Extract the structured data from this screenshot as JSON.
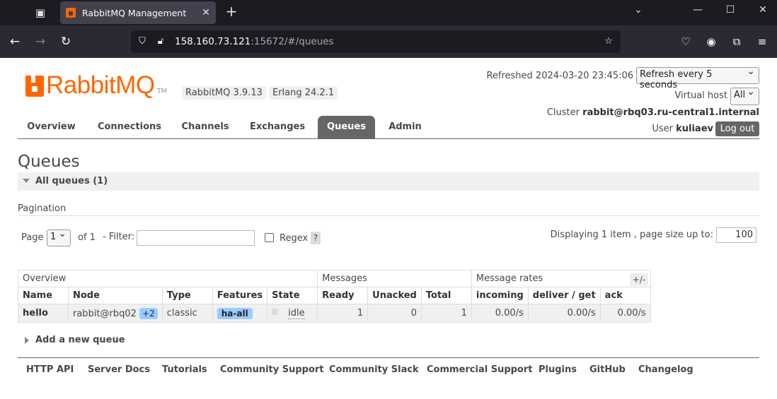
{
  "browser": {
    "tab_title": "RabbitMQ Management",
    "url_host": "158.160.73.121",
    "url_rest": ":15672/#/queues"
  },
  "header": {
    "logo_text": "RabbitMQ",
    "logo_tm": "TM",
    "rabbitmq_version": "RabbitMQ 3.9.13",
    "erlang_version": "Erlang 24.2.1",
    "refreshed": "Refreshed 2024-03-20 23:45:06",
    "refresh_select": "Refresh every 5 seconds",
    "vhost_label": "Virtual host",
    "vhost_select": "All",
    "cluster_label": "Cluster",
    "cluster_name": "rabbit@rbq03.ru-central1.internal",
    "user_label": "User",
    "user_name": "kuliaev",
    "logout": "Log out"
  },
  "tabs": [
    "Overview",
    "Connections",
    "Channels",
    "Exchanges",
    "Queues",
    "Admin"
  ],
  "active_tab": "Queues",
  "main": {
    "title": "Queues",
    "section": "All queues (1)",
    "pagination_title": "Pagination",
    "page_label": "Page",
    "page_select": "1",
    "of_label": "of 1",
    "filter_label": "- Filter:",
    "filter_value": "",
    "regex_label": "Regex",
    "help": "?",
    "displaying": "Displaying 1 item , page size up to:",
    "page_size": "100",
    "plusminus": "+/-",
    "add_queue": "Add a new queue"
  },
  "table": {
    "groups": [
      "Overview",
      "Messages",
      "Message rates"
    ],
    "headers": [
      "Name",
      "Node",
      "Type",
      "Features",
      "State",
      "Ready",
      "Unacked",
      "Total",
      "incoming",
      "deliver / get",
      "ack"
    ],
    "rows": [
      {
        "name": "hello",
        "node": "rabbit@rbq02",
        "node_extra": "+2",
        "type": "classic",
        "features": "ha-all",
        "state": "idle",
        "ready": "1",
        "unacked": "0",
        "total": "1",
        "incoming": "0.00/s",
        "deliver_get": "0.00/s",
        "ack": "0.00/s"
      }
    ]
  },
  "footer": [
    "HTTP API",
    "Server Docs",
    "Tutorials",
    "Community Support",
    "Community Slack",
    "Commercial Support",
    "Plugins",
    "GitHub",
    "Changelog"
  ],
  "colors": {
    "brand": "#ff6600",
    "tab_active": "#666666",
    "pill": "#99ccff"
  }
}
